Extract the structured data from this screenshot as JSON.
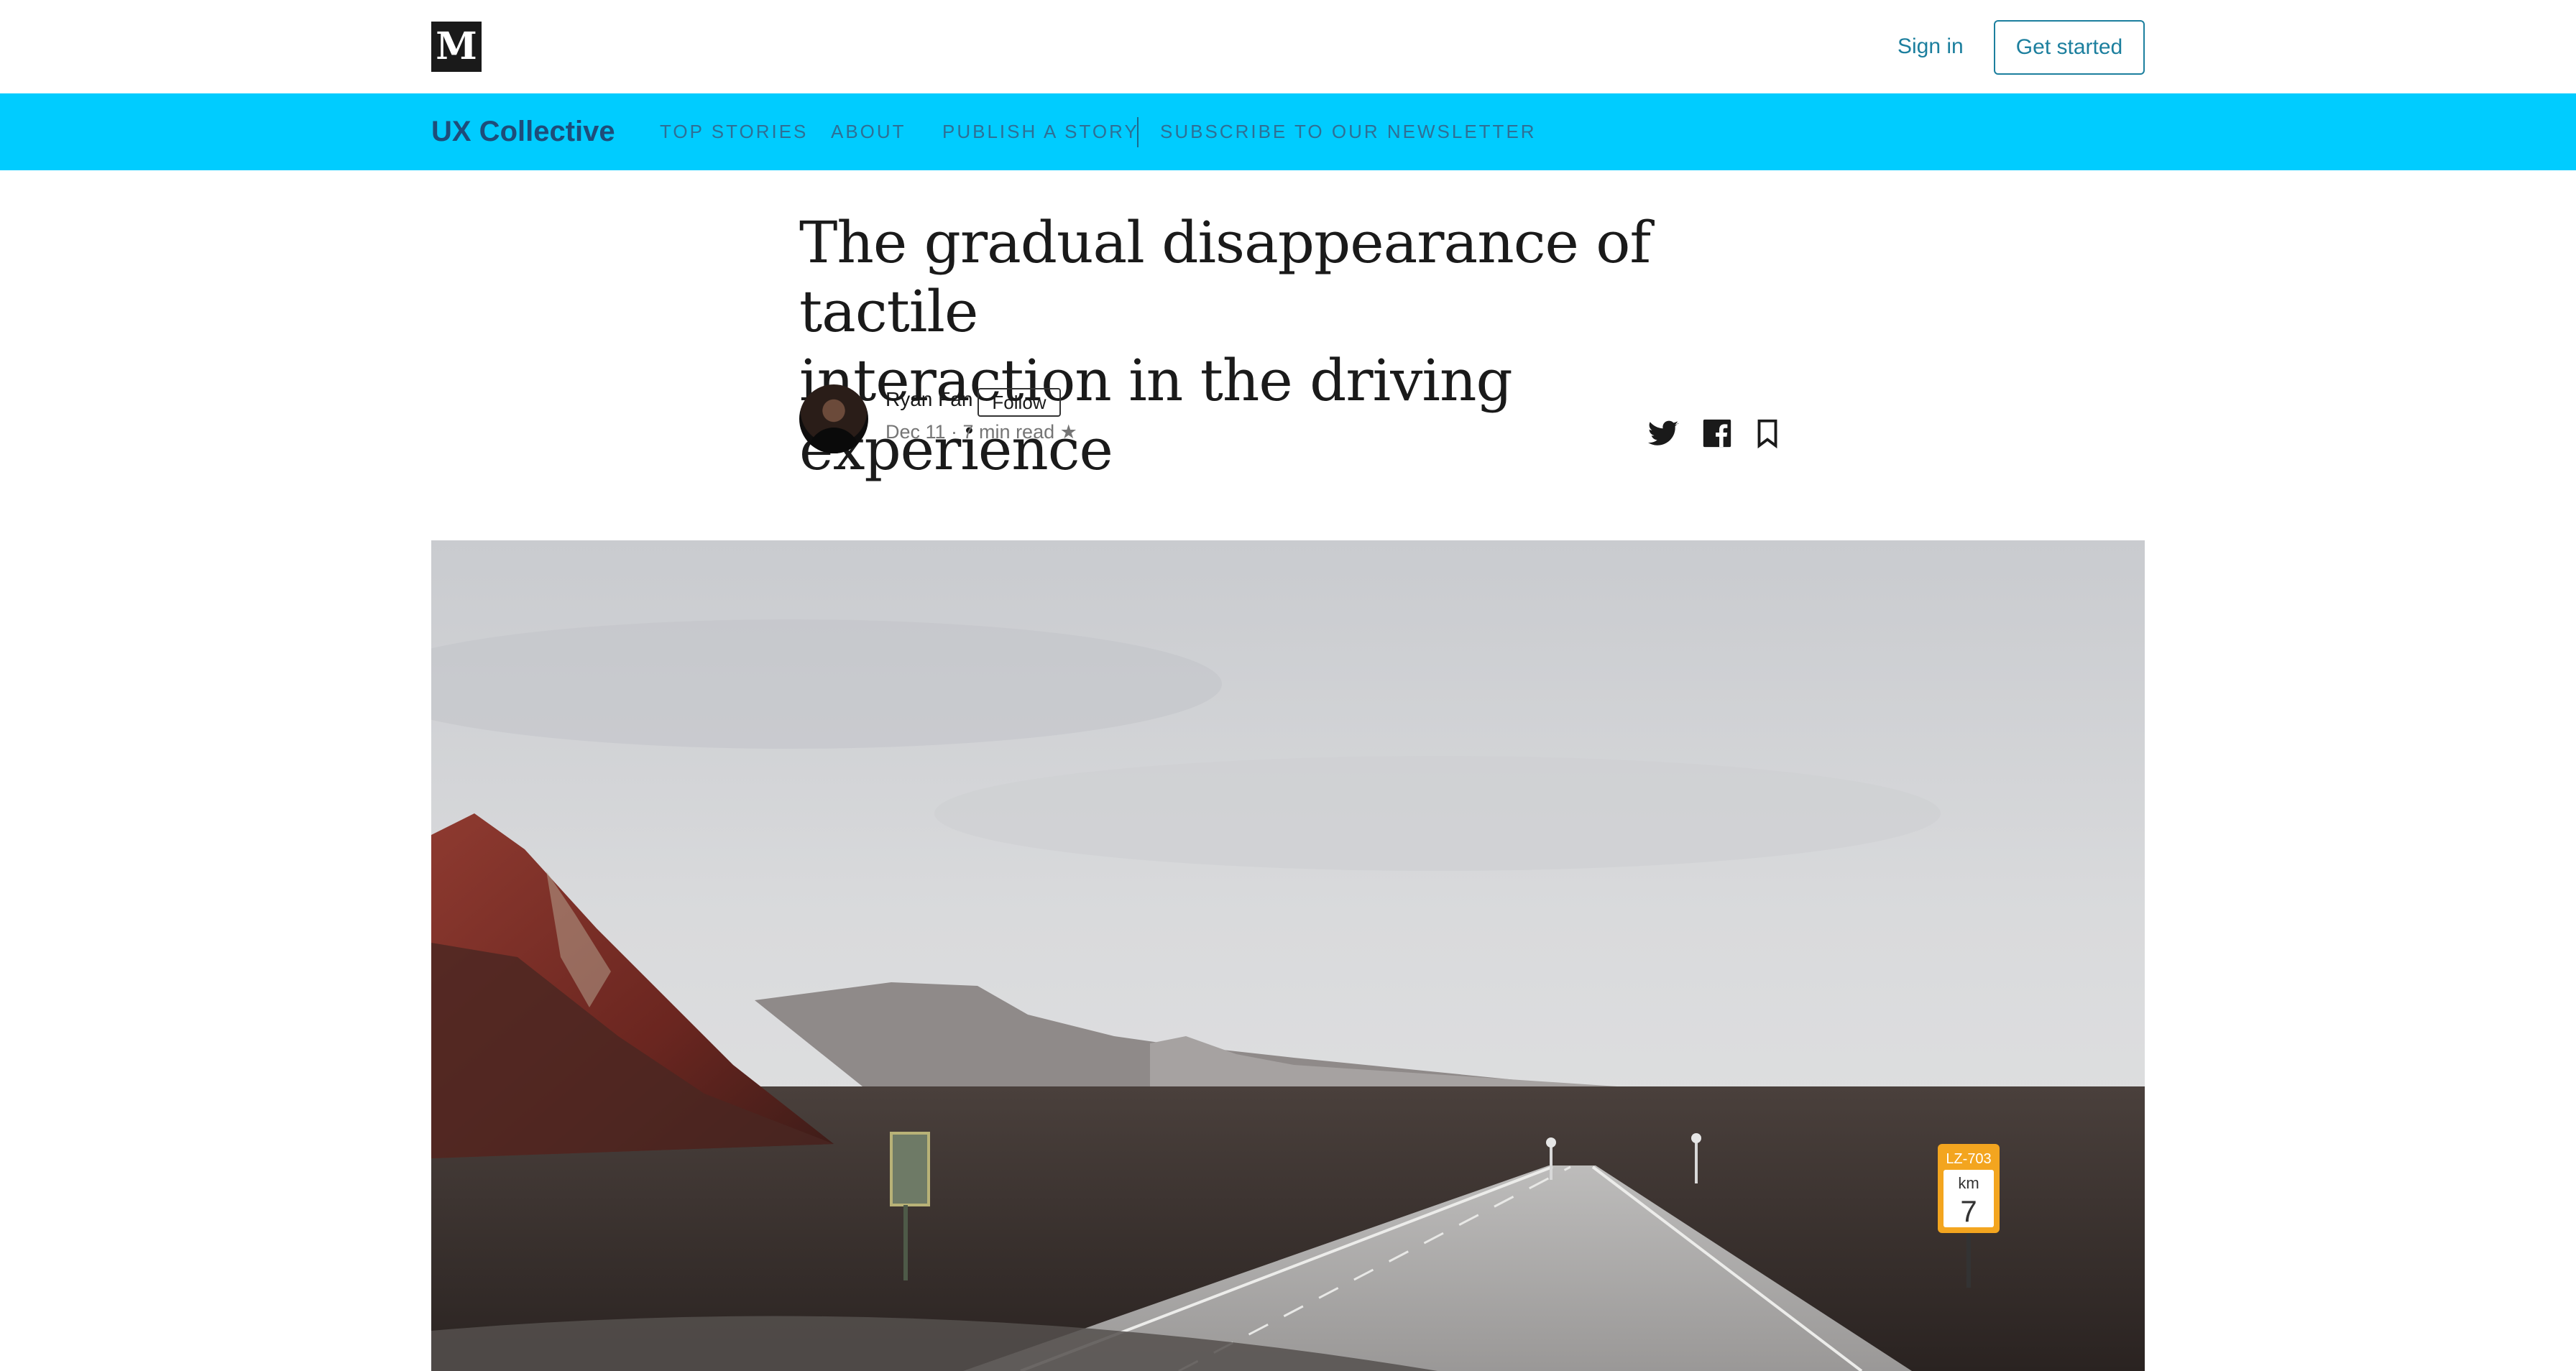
{
  "topbar": {
    "logo_letter": "M",
    "signin_label": "Sign in",
    "get_started_label": "Get started"
  },
  "publication": {
    "name": "UX Collective",
    "nav": [
      "TOP STORIES",
      "ABOUT",
      "PUBLISH A STORY",
      "SUBSCRIBE TO OUR NEWSLETTER"
    ],
    "bar_color": "#00ccff"
  },
  "article": {
    "title_line1": "The gradual disappearance of tactile",
    "title_line2": "interaction in the driving experience",
    "author": "Ryan Fan",
    "follow_label": "Follow",
    "meta": "Dec 11 · 7 min read ★",
    "share_icons": [
      "twitter-icon",
      "facebook-icon",
      "bookmark-icon"
    ]
  },
  "hero": {
    "sign_route": "LZ-703",
    "sign_unit": "km",
    "sign_number": "7"
  }
}
